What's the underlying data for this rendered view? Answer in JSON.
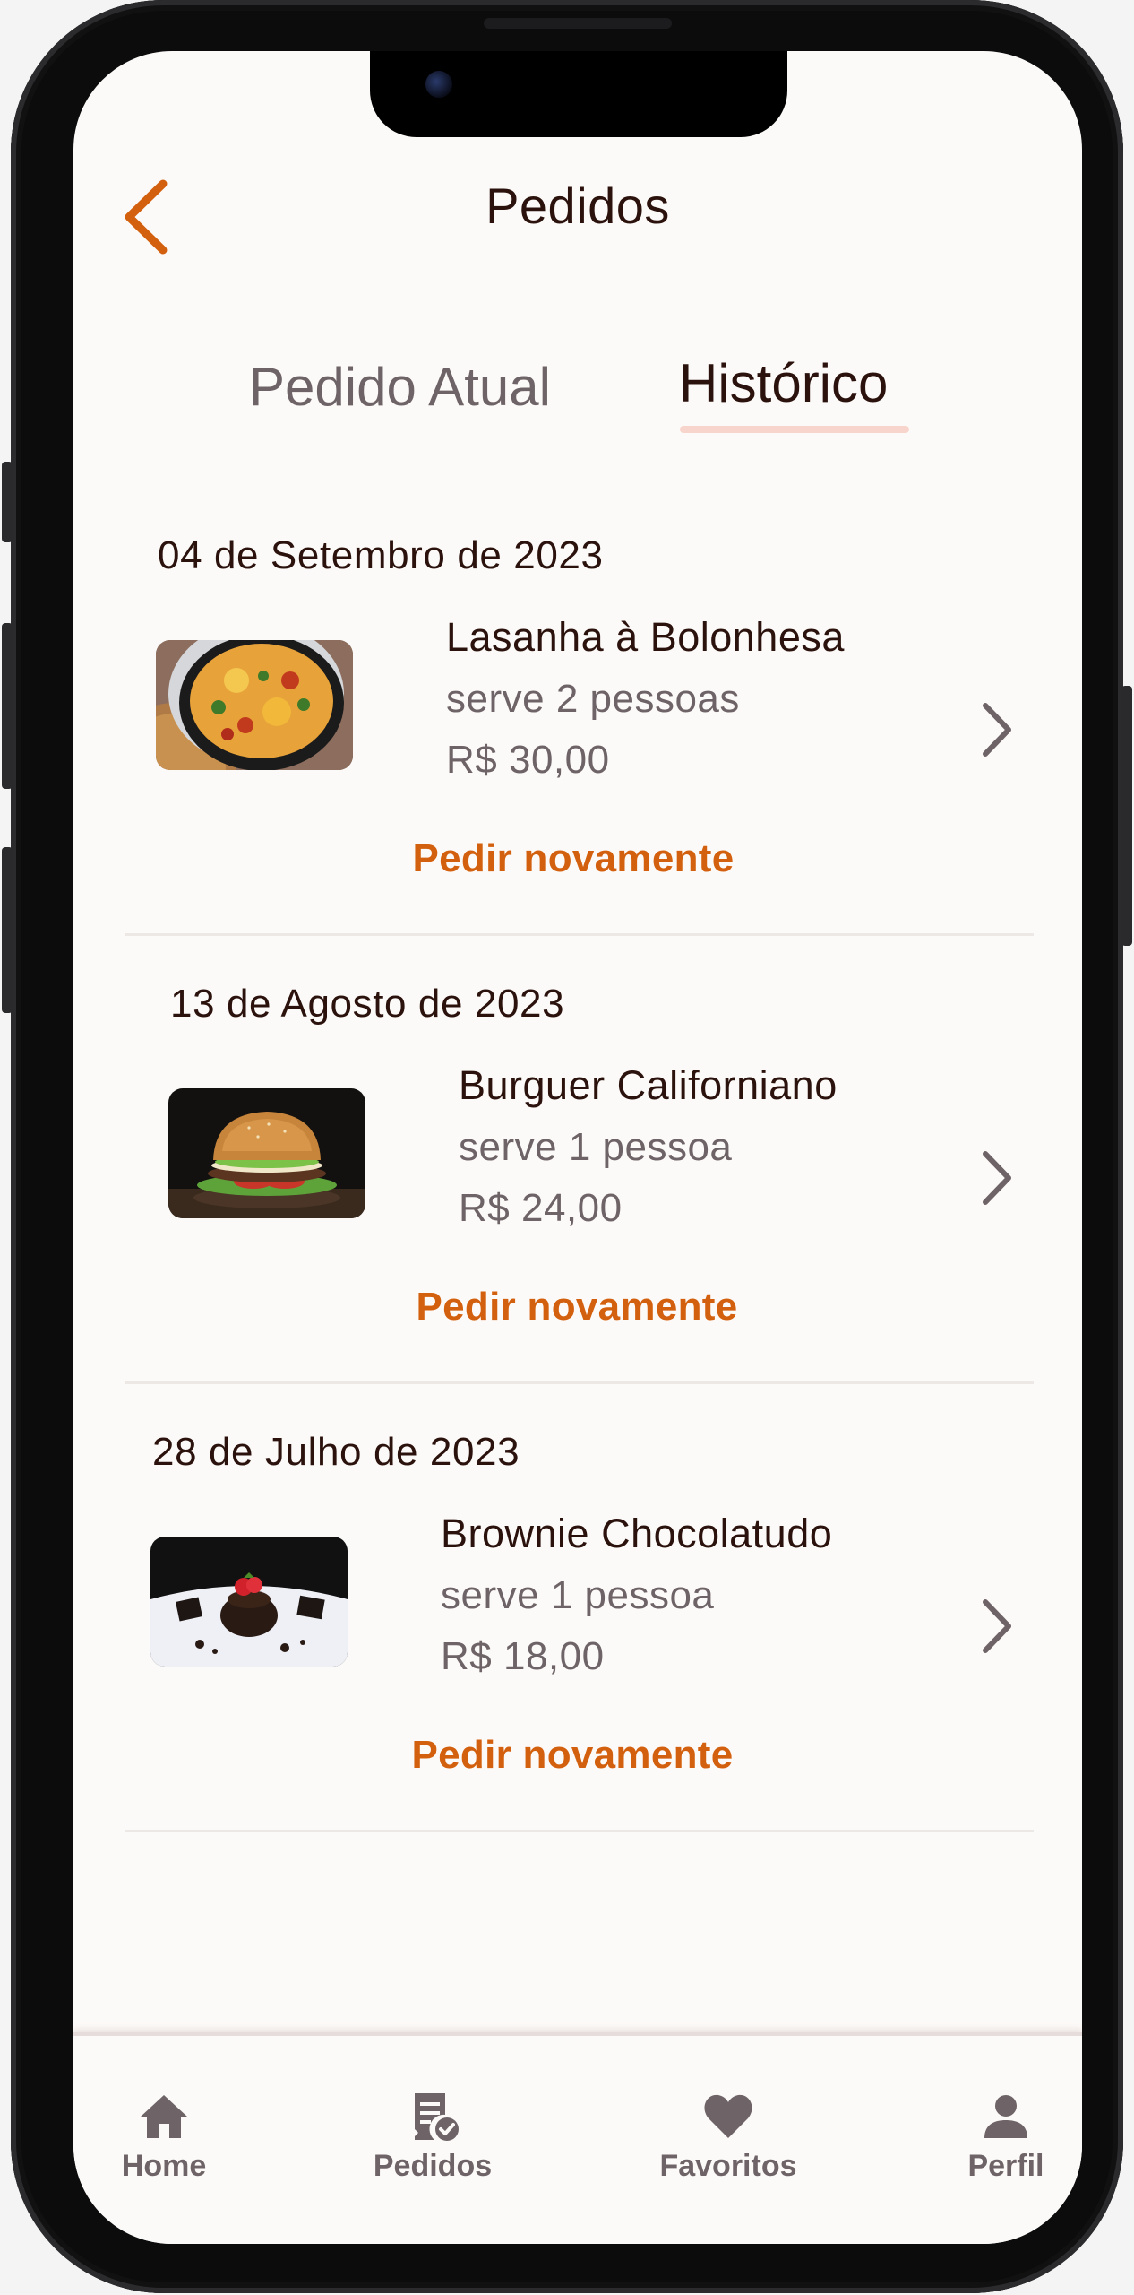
{
  "header": {
    "title": "Pedidos"
  },
  "tabs": [
    {
      "label": "Pedido Atual",
      "active": false
    },
    {
      "label": "Histórico",
      "active": true
    }
  ],
  "orders": [
    {
      "date": "04 de Setembro de 2023",
      "name": "Lasanha à Bolonhesa",
      "serves": "serve 2 pessoas",
      "price": "R$ 30,00",
      "action": "Pedir novamente",
      "image": "lasagna-photo"
    },
    {
      "date": "13 de Agosto de 2023",
      "name": "Burguer Californiano",
      "serves": "serve 1 pessoa",
      "price": "R$ 24,00",
      "action": "Pedir novamente",
      "image": "burger-photo"
    },
    {
      "date": "28 de Julho de 2023",
      "name": "Brownie Chocolatudo",
      "serves": "serve 1 pessoa",
      "price": "R$ 18,00",
      "action": "Pedir novamente",
      "image": "brownie-photo"
    }
  ],
  "nav": [
    {
      "label": "Home",
      "icon": "home-icon"
    },
    {
      "label": "Pedidos",
      "icon": "receipt-check-icon",
      "active": true
    },
    {
      "label": "Favoritos",
      "icon": "heart-icon"
    },
    {
      "label": "Perfil",
      "icon": "person-icon"
    }
  ],
  "colors": {
    "accent": "#d3600e",
    "text_dark": "#2b120d",
    "text_muted": "#6e6467",
    "tab_underline": "#f8d5cc",
    "background": "#fcfaf8"
  }
}
